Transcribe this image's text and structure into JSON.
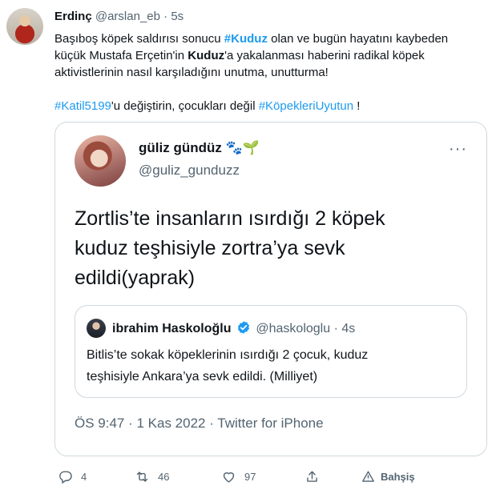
{
  "tweet": {
    "author_name": "Erdinç",
    "author_handle": "@arslan_eb",
    "separator": "·",
    "time": "5s",
    "text": {
      "l1_a": "Başıboş köpek saldırısı sonucu ",
      "l1_tag": "#Kuduz",
      "l1_b": " olan ve bugün hayatını kaybeden",
      "l2_a": "küçük Mustafa Erçetin'in ",
      "l2_bold": "Kuduz",
      "l2_b": "'a yakalanması haberini radikal köpek",
      "l3": "aktivistlerinin nasıl karşıladığını unutma, unutturma!",
      "l4_tag1": "#Katil5199",
      "l4_a": "'u değiştirin, çocukları değil ",
      "l4_tag2": "#KöpekleriUyutun",
      "l4_b": " !"
    }
  },
  "quote": {
    "name": "güliz gündüz",
    "emojis": {
      "paw": "🐾",
      "sprout": "🌱"
    },
    "handle": "@guliz_gunduzz",
    "more": "···",
    "text_lines": [
      "Zortlis’te insanların ısırdığı 2 köpek",
      "kuduz teşhisiyle zortra’ya sevk",
      "edildi(yaprak)"
    ],
    "meta": "ÖS 9:47 · 1 Kas 2022 · Twitter for iPhone"
  },
  "nested": {
    "name": "ibrahim Haskoloğlu",
    "handle": "@haskologlu",
    "separator": "·",
    "time": "4s",
    "text_lines": [
      "Bitlis’te sokak köpeklerinin ısırdığı 2 çocuk, kuduz",
      "teşhisiyle Ankara’ya sevk edildi. (Milliyet)"
    ]
  },
  "actions": {
    "reply_count": "4",
    "retweet_count": "46",
    "like_count": "97",
    "tip_label": "Bahşiş"
  },
  "colors": {
    "link": "#1d9bf0",
    "muted": "#536471",
    "border": "#cfd9de"
  }
}
